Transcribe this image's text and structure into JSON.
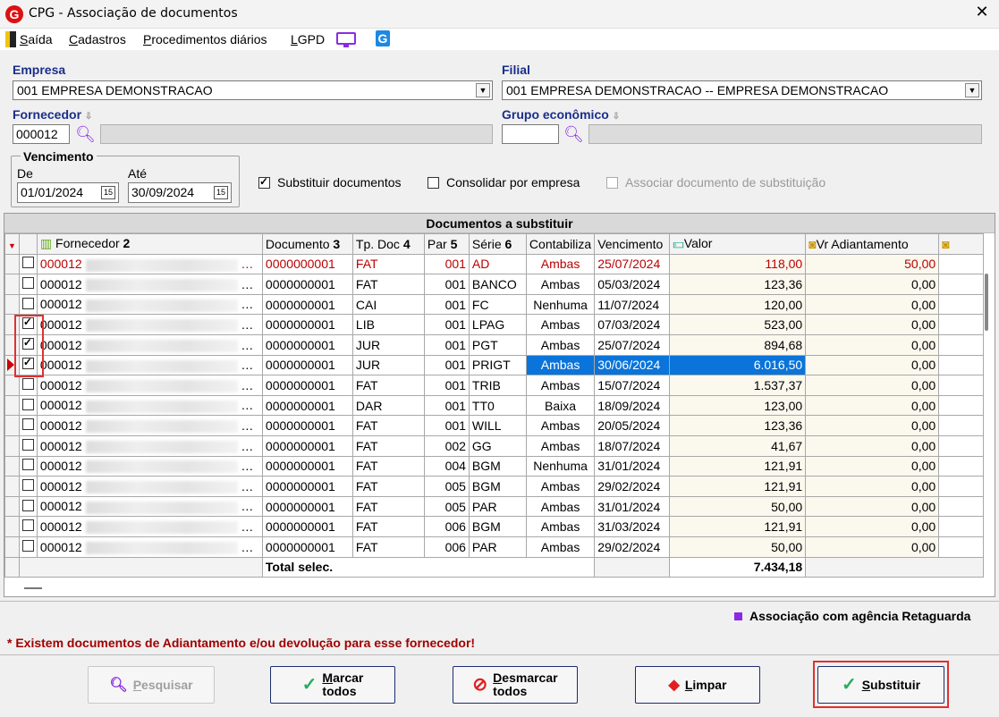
{
  "window": {
    "title": "CPG - Associação de documentos",
    "logo_letter": "G",
    "close_label": "✕"
  },
  "menu": {
    "items": [
      {
        "prefix": "S",
        "rest": "aída"
      },
      {
        "prefix": "C",
        "rest": "adastros"
      },
      {
        "prefix": "P",
        "rest": "rocedimentos diários"
      },
      {
        "prefix": "L",
        "rest": "GPD"
      }
    ],
    "g_icon": "G"
  },
  "form": {
    "empresa_label": "Empresa",
    "empresa_value": "001 EMPRESA DEMONSTRACAO",
    "filial_label": "Filial",
    "filial_value": "001 EMPRESA DEMONSTRACAO -- EMPRESA DEMONSTRACAO",
    "fornecedor_label": "Fornecedor",
    "fornecedor_code": "000012",
    "grupo_label": "Grupo econômico",
    "grupo_code": "",
    "vencimento_label": "Vencimento",
    "de_label": "De",
    "de_value": "01/01/2024",
    "ate_label": "Até",
    "ate_value": "30/09/2024",
    "calendar_day": "15",
    "substituir_label": "Substituir documentos",
    "substituir_checked": true,
    "consolidar_label": "Consolidar por empresa",
    "consolidar_checked": false,
    "associar_label": "Associar documento de substituição",
    "associar_checked": false
  },
  "grid": {
    "title": "Documentos a substituir",
    "columns": {
      "fornecedor": "Fornecedor",
      "fornecedor_n": "2",
      "documento": "Documento",
      "documento_n": "3",
      "tpdoc": "Tp. Doc",
      "tpdoc_n": "4",
      "par": "Par",
      "par_n": "5",
      "serie": "Série",
      "serie_n": "6",
      "contabiliza": "Contabiliza",
      "vencimento": "Vencimento",
      "valor": "Valor",
      "vr_adiantamento": "Vr Adiantamento"
    },
    "rows": [
      {
        "checked": false,
        "fornecedor": "000012",
        "documento": "0000000001",
        "tpdoc": "FAT",
        "par": "001",
        "serie": "AD",
        "contabiliza": "Ambas",
        "vencimento": "25/07/2024",
        "valor": "118,00",
        "vr_adiantamento": "50,00",
        "style": "red"
      },
      {
        "checked": false,
        "fornecedor": "000012",
        "documento": "0000000001",
        "tpdoc": "FAT",
        "par": "001",
        "serie": "BANCO",
        "contabiliza": "Ambas",
        "vencimento": "05/03/2024",
        "valor": "123,36",
        "vr_adiantamento": "0,00",
        "style": ""
      },
      {
        "checked": false,
        "fornecedor": "000012",
        "documento": "0000000001",
        "tpdoc": "CAI",
        "par": "001",
        "serie": "FC",
        "contabiliza": "Nenhuma",
        "vencimento": "11/07/2024",
        "valor": "120,00",
        "vr_adiantamento": "0,00",
        "style": ""
      },
      {
        "checked": true,
        "fornecedor": "000012",
        "documento": "0000000001",
        "tpdoc": "LIB",
        "par": "001",
        "serie": "LPAG",
        "contabiliza": "Ambas",
        "vencimento": "07/03/2024",
        "valor": "523,00",
        "vr_adiantamento": "0,00",
        "style": ""
      },
      {
        "checked": true,
        "fornecedor": "000012",
        "documento": "0000000001",
        "tpdoc": "JUR",
        "par": "001",
        "serie": "PGT",
        "contabiliza": "Ambas",
        "vencimento": "25/07/2024",
        "valor": "894,68",
        "vr_adiantamento": "0,00",
        "style": ""
      },
      {
        "checked": true,
        "fornecedor": "000012",
        "documento": "0000000001",
        "tpdoc": "JUR",
        "par": "001",
        "serie": "PRIGT",
        "contabiliza": "Ambas",
        "vencimento": "30/06/2024",
        "valor": "6.016,50",
        "vr_adiantamento": "0,00",
        "style": "selected"
      },
      {
        "checked": false,
        "fornecedor": "000012",
        "documento": "0000000001",
        "tpdoc": "FAT",
        "par": "001",
        "serie": "TRIB",
        "contabiliza": "Ambas",
        "vencimento": "15/07/2024",
        "valor": "1.537,37",
        "vr_adiantamento": "0,00",
        "style": ""
      },
      {
        "checked": false,
        "fornecedor": "000012",
        "documento": "0000000001",
        "tpdoc": "DAR",
        "par": "001",
        "serie": "TT0",
        "contabiliza": "Baixa",
        "vencimento": "18/09/2024",
        "valor": "123,00",
        "vr_adiantamento": "0,00",
        "style": ""
      },
      {
        "checked": false,
        "fornecedor": "000012",
        "documento": "0000000001",
        "tpdoc": "FAT",
        "par": "001",
        "serie": "WILL",
        "contabiliza": "Ambas",
        "vencimento": "20/05/2024",
        "valor": "123,36",
        "vr_adiantamento": "0,00",
        "style": ""
      },
      {
        "checked": false,
        "fornecedor": "000012",
        "documento": "0000000001",
        "tpdoc": "FAT",
        "par": "002",
        "serie": "GG",
        "contabiliza": "Ambas",
        "vencimento": "18/07/2024",
        "valor": "41,67",
        "vr_adiantamento": "0,00",
        "style": ""
      },
      {
        "checked": false,
        "fornecedor": "000012",
        "documento": "0000000001",
        "tpdoc": "FAT",
        "par": "004",
        "serie": "BGM",
        "contabiliza": "Nenhuma",
        "vencimento": "31/01/2024",
        "valor": "121,91",
        "vr_adiantamento": "0,00",
        "style": ""
      },
      {
        "checked": false,
        "fornecedor": "000012",
        "documento": "0000000001",
        "tpdoc": "FAT",
        "par": "005",
        "serie": "BGM",
        "contabiliza": "Ambas",
        "vencimento": "29/02/2024",
        "valor": "121,91",
        "vr_adiantamento": "0,00",
        "style": ""
      },
      {
        "checked": false,
        "fornecedor": "000012",
        "documento": "0000000001",
        "tpdoc": "FAT",
        "par": "005",
        "serie": "PAR",
        "contabiliza": "Ambas",
        "vencimento": "31/01/2024",
        "valor": "50,00",
        "vr_adiantamento": "0,00",
        "style": ""
      },
      {
        "checked": false,
        "fornecedor": "000012",
        "documento": "0000000001",
        "tpdoc": "FAT",
        "par": "006",
        "serie": "BGM",
        "contabiliza": "Ambas",
        "vencimento": "31/03/2024",
        "valor": "121,91",
        "vr_adiantamento": "0,00",
        "style": ""
      },
      {
        "checked": false,
        "fornecedor": "000012",
        "documento": "0000000001",
        "tpdoc": "FAT",
        "par": "006",
        "serie": "PAR",
        "contabiliza": "Ambas",
        "vencimento": "29/02/2024",
        "valor": "50,00",
        "vr_adiantamento": "0,00",
        "style": ""
      }
    ],
    "total_label": "Total selec.",
    "total_value": "7.434,18"
  },
  "legend": {
    "label": "Associação com agência Retaguarda",
    "color": "#8a2be2"
  },
  "warning": "* Existem documentos de Adiantamento e/ou devolução para esse fornecedor!",
  "buttons": {
    "pesquisar": {
      "u": "P",
      "rest": "esquisar"
    },
    "marcar": {
      "u": "M",
      "rest": "arcar",
      "line2": "todos"
    },
    "desmarcar": {
      "u": "D",
      "rest": "esmarcar",
      "line2": "todos"
    },
    "limpar": {
      "u": "L",
      "rest": "impar"
    },
    "substituir": {
      "u": "S",
      "rest": "ubstituir"
    }
  },
  "colors": {
    "accent": "#1a2e8a",
    "selection": "#0a74da",
    "red": "#b00000",
    "highlight_box": "#e03030"
  }
}
